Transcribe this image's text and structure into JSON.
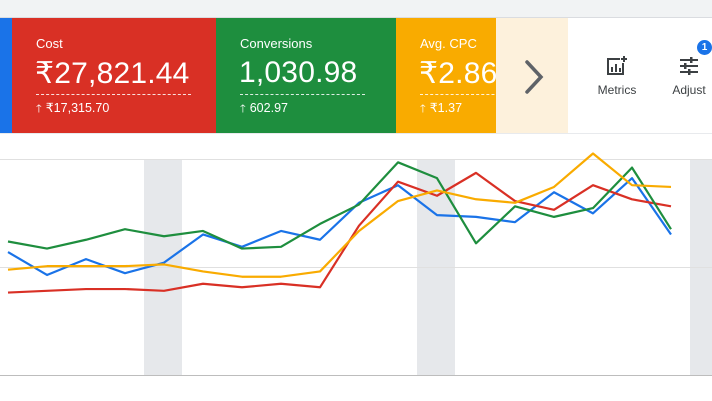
{
  "colors": {
    "blue": "#1a73e8",
    "red": "#d93025",
    "green": "#1e8e3e",
    "yellow": "#f9ab00",
    "more_tile": "#fdf1dc",
    "gray_band": "#e6e8eb",
    "grid": "#e0e0e0"
  },
  "cards": [
    {
      "title": "Cost",
      "value": "₹27,821.44",
      "change": "₹17,315.70",
      "color": "#d93025"
    },
    {
      "title": "Conversions",
      "value": "1,030.98",
      "change": "602.97",
      "color": "#1e8e3e"
    },
    {
      "title": "Avg. CPC",
      "value": "₹2.86",
      "change": "₹1.37",
      "color": "#f9ab00"
    }
  ],
  "icons": {
    "change_up": "arrow-up-icon",
    "more": "chevron-right-icon",
    "metrics": "add-chart-icon",
    "adjust": "tune-sliders-icon"
  },
  "buttons": {
    "metrics_label": "Metrics",
    "adjust_label": "Adjust",
    "adjust_badge": "1"
  },
  "chart_data": {
    "type": "line",
    "x": [
      0,
      1,
      2,
      3,
      4,
      5,
      6,
      7,
      8,
      9,
      10,
      11,
      12,
      13,
      14,
      15,
      16,
      17
    ],
    "ylim": [
      0,
      100
    ],
    "grid": true,
    "shaded_ranges": [
      [
        2,
        3
      ],
      [
        9,
        10
      ],
      [
        16,
        17
      ]
    ],
    "series": [
      {
        "color": "#1a73e8",
        "values": [
          42,
          29,
          38,
          30,
          36,
          52,
          45,
          54,
          49,
          70,
          80,
          63,
          62,
          59,
          76,
          64,
          84,
          52
        ]
      },
      {
        "color": "#d93025",
        "values": [
          19,
          20,
          21,
          21,
          20,
          24,
          22,
          24,
          22,
          57,
          82,
          74,
          87,
          71,
          66,
          80,
          72,
          68
        ]
      },
      {
        "color": "#1e8e3e",
        "values": [
          48,
          44,
          49,
          55,
          51,
          54,
          44,
          45,
          58,
          69,
          93,
          84,
          47,
          68,
          62,
          67,
          90,
          55
        ]
      },
      {
        "color": "#f9ab00",
        "values": [
          32,
          34,
          34,
          34,
          35,
          31,
          28,
          28,
          31,
          54,
          71,
          77,
          72,
          70,
          79,
          98,
          80,
          79
        ]
      }
    ]
  }
}
